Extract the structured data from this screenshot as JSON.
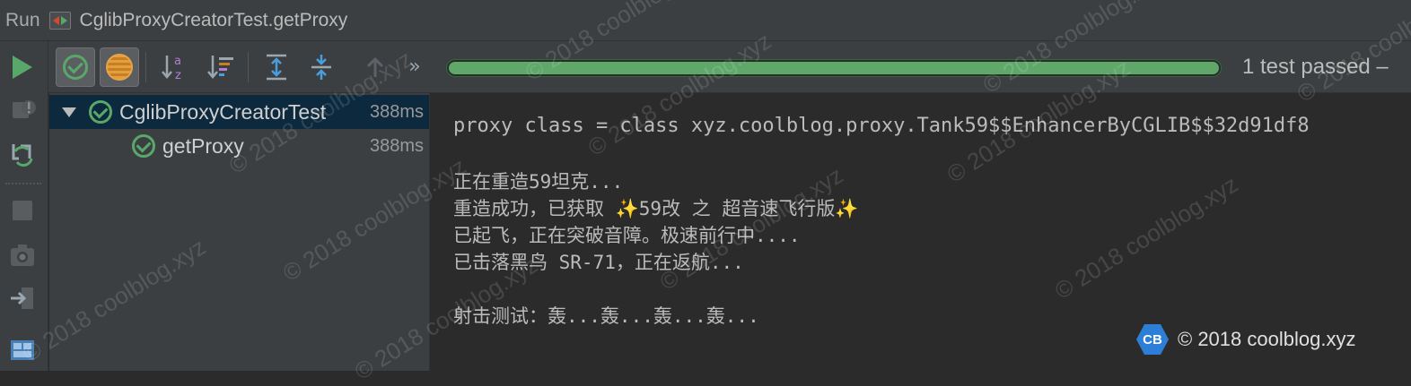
{
  "window": {
    "run_label": "Run",
    "config_name": "CglibProxyCreatorTest.getProxy"
  },
  "left_strip": {
    "buttons": [
      "rerun-icon",
      "stop-icon",
      "rerun-failed-icon",
      "pause-icon",
      "screenshot-icon",
      "exit-icon",
      "layout-icon"
    ]
  },
  "toolbar": {
    "buttons": [
      {
        "name": "show-passed-toggle",
        "icon": "check-circle-icon",
        "toggled": true
      },
      {
        "name": "show-ignored-toggle",
        "icon": "ignored-circle-icon",
        "toggled": true
      },
      {
        "name": "sort-alphabetically",
        "icon": "sort-alpha-icon"
      },
      {
        "name": "sort-by-duration",
        "icon": "sort-duration-icon"
      },
      {
        "name": "expand-all",
        "icon": "expand-all-icon"
      },
      {
        "name": "collapse-all",
        "icon": "collapse-all-icon"
      },
      {
        "name": "previous-failed",
        "icon": "arrow-up-icon"
      },
      {
        "name": "more",
        "icon": "double-chevron-icon",
        "glyph": "»"
      }
    ],
    "progress_percent": 100,
    "status_text": "1 test passed –"
  },
  "colors": {
    "passed": "#59a869",
    "progress": "#5fa86a",
    "selected_row": "#0d293e",
    "badge": "#2d7ed6"
  },
  "tree": [
    {
      "name": "CglibProxyCreatorTest",
      "time": "388ms",
      "expanded": true,
      "selected": true,
      "status": "passed"
    },
    {
      "name": "getProxy",
      "time": "388ms",
      "selected": false,
      "status": "passed"
    }
  ],
  "console": {
    "lines": [
      "proxy class = class xyz.coolblog.proxy.Tank59$$EnhancerByCGLIB$$32d91df8",
      "",
      "正在重造59坦克...",
      "重造成功，已获取 ✨59改 之 超音速飞行版✨",
      "已起飞，正在突破音障。极速前行中....",
      "已击落黑鸟 SR-71，正在返航...",
      "",
      "射击测试：轰...轰...轰...轰..."
    ]
  },
  "watermark": {
    "text": "© 2018 coolblog.xyz",
    "badge_initials": "CB",
    "badge_text": "© 2018 coolblog.xyz"
  }
}
